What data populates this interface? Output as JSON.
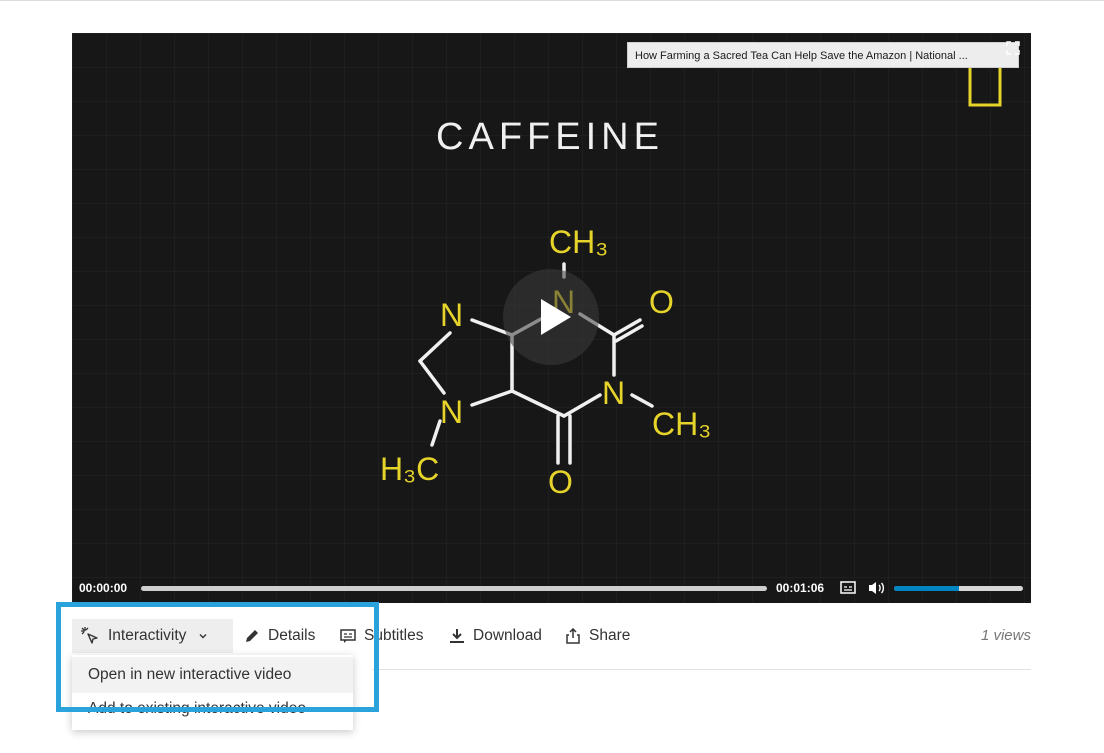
{
  "video": {
    "embed_title": "How Farming a Sacred Tea Can Help Save the Amazon | National ...",
    "frame_caption": "CAFFEINE",
    "molecule_labels": {
      "ch3_top": "CH₃",
      "o_right": "O",
      "n_top": "N",
      "n_left_top": "N",
      "n_right": "N",
      "ch3_right": "CH₃",
      "n_left_bottom": "N",
      "h3c": "H₃C",
      "o_bottom": "O"
    },
    "current_time": "00:00:00",
    "duration": "00:01:06",
    "progress_fraction": 0.0,
    "volume_fraction": 0.5
  },
  "toolbar": {
    "interactivity_label": "Interactivity",
    "details_label": "Details",
    "subtitles_label": "Subtitles",
    "download_label": "Download",
    "share_label": "Share",
    "views": "1 views"
  },
  "interactivity_menu": {
    "items": [
      {
        "label": "Open in new interactive video"
      },
      {
        "label": "Add to existing interactive video"
      }
    ]
  },
  "colors": {
    "accent": "#2aa3dc",
    "volume": "#0085c3",
    "molecule_yellow": "#e6d42a"
  }
}
